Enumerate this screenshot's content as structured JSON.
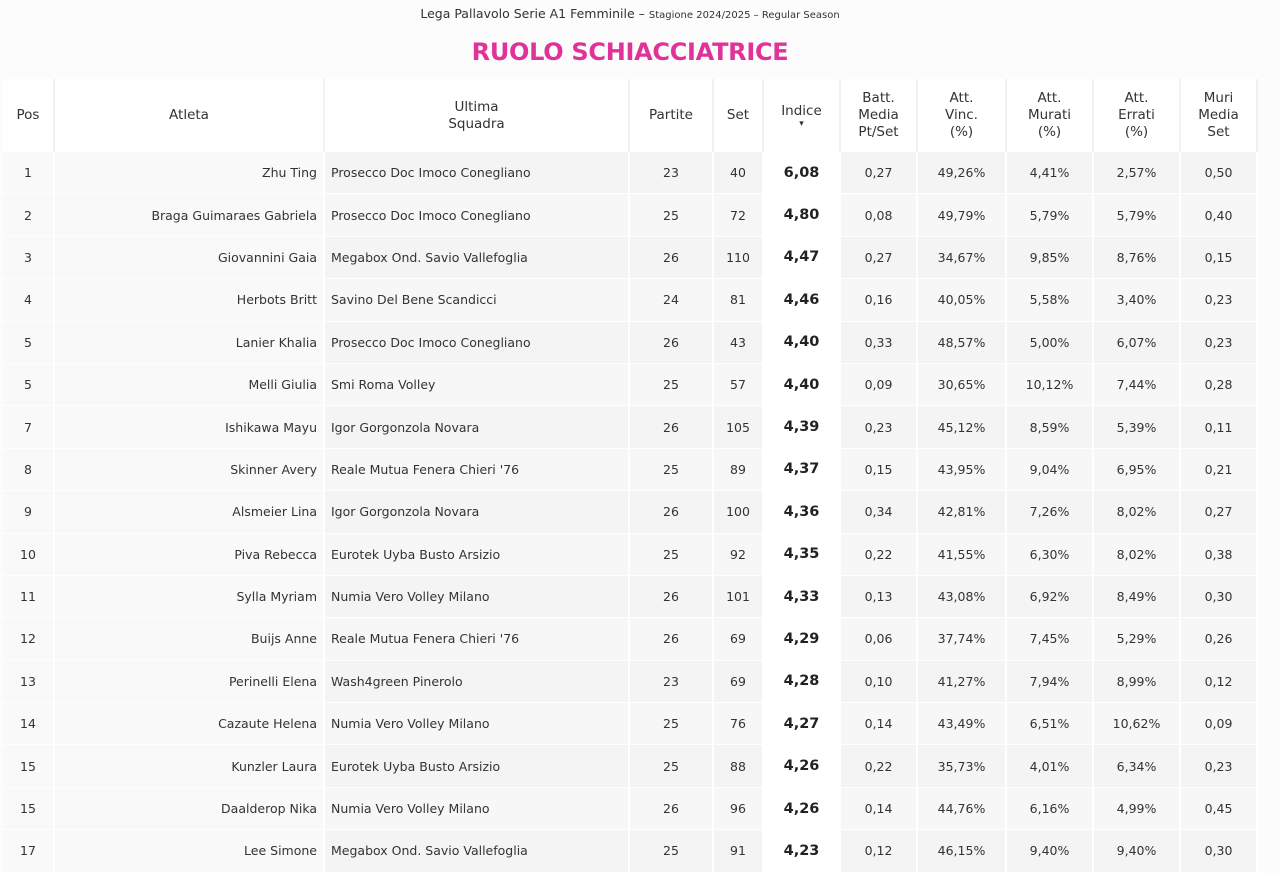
{
  "header": {
    "league": "Lega Pallavolo Serie A1 Femminile –",
    "season": "Stagione 2024/2025 – Regular Season",
    "title": "RUOLO SCHIACCIATRICE"
  },
  "columns": {
    "pos": "Pos",
    "atleta": "Atleta",
    "squadra_1": "Ultima",
    "squadra_2": "Squadra",
    "partite": "Partite",
    "set": "Set",
    "indice": "Indice",
    "sort_icon": "▾",
    "batt_1": "Batt.",
    "batt_2": "Media",
    "batt_3": "Pt/Set",
    "vinc_1": "Att.",
    "vinc_2": "Vinc.",
    "vinc_3": "(%)",
    "murati_1": "Att.",
    "murati_2": "Murati",
    "murati_3": "(%)",
    "errati_1": "Att.",
    "errati_2": "Errati",
    "errati_3": "(%)",
    "muri_1": "Muri",
    "muri_2": "Media",
    "muri_3": "Set"
  },
  "rows": [
    {
      "pos": "1",
      "atleta": "Zhu Ting",
      "squadra": "Prosecco Doc Imoco Conegliano",
      "partite": "23",
      "set": "40",
      "indice": "6,08",
      "batt": "0,27",
      "vinc": "49,26%",
      "murati": "4,41%",
      "errati": "2,57%",
      "muri": "0,50"
    },
    {
      "pos": "2",
      "atleta": "Braga Guimaraes Gabriela",
      "squadra": "Prosecco Doc Imoco Conegliano",
      "partite": "25",
      "set": "72",
      "indice": "4,80",
      "batt": "0,08",
      "vinc": "49,79%",
      "murati": "5,79%",
      "errati": "5,79%",
      "muri": "0,40"
    },
    {
      "pos": "3",
      "atleta": "Giovannini Gaia",
      "squadra": "Megabox Ond. Savio Vallefoglia",
      "partite": "26",
      "set": "110",
      "indice": "4,47",
      "batt": "0,27",
      "vinc": "34,67%",
      "murati": "9,85%",
      "errati": "8,76%",
      "muri": "0,15"
    },
    {
      "pos": "4",
      "atleta": "Herbots Britt",
      "squadra": "Savino Del Bene Scandicci",
      "partite": "24",
      "set": "81",
      "indice": "4,46",
      "batt": "0,16",
      "vinc": "40,05%",
      "murati": "5,58%",
      "errati": "3,40%",
      "muri": "0,23"
    },
    {
      "pos": "5",
      "atleta": "Lanier Khalia",
      "squadra": "Prosecco Doc Imoco Conegliano",
      "partite": "26",
      "set": "43",
      "indice": "4,40",
      "batt": "0,33",
      "vinc": "48,57%",
      "murati": "5,00%",
      "errati": "6,07%",
      "muri": "0,23"
    },
    {
      "pos": "5",
      "atleta": "Melli Giulia",
      "squadra": "Smi Roma Volley",
      "partite": "25",
      "set": "57",
      "indice": "4,40",
      "batt": "0,09",
      "vinc": "30,65%",
      "murati": "10,12%",
      "errati": "7,44%",
      "muri": "0,28"
    },
    {
      "pos": "7",
      "atleta": "Ishikawa Mayu",
      "squadra": "Igor Gorgonzola Novara",
      "partite": "26",
      "set": "105",
      "indice": "4,39",
      "batt": "0,23",
      "vinc": "45,12%",
      "murati": "8,59%",
      "errati": "5,39%",
      "muri": "0,11"
    },
    {
      "pos": "8",
      "atleta": "Skinner Avery",
      "squadra": "Reale Mutua Fenera Chieri '76",
      "partite": "25",
      "set": "89",
      "indice": "4,37",
      "batt": "0,15",
      "vinc": "43,95%",
      "murati": "9,04%",
      "errati": "6,95%",
      "muri": "0,21"
    },
    {
      "pos": "9",
      "atleta": "Alsmeier Lina",
      "squadra": "Igor Gorgonzola Novara",
      "partite": "26",
      "set": "100",
      "indice": "4,36",
      "batt": "0,34",
      "vinc": "42,81%",
      "murati": "7,26%",
      "errati": "8,02%",
      "muri": "0,27"
    },
    {
      "pos": "10",
      "atleta": "Piva Rebecca",
      "squadra": "Eurotek Uyba Busto Arsizio",
      "partite": "25",
      "set": "92",
      "indice": "4,35",
      "batt": "0,22",
      "vinc": "41,55%",
      "murati": "6,30%",
      "errati": "8,02%",
      "muri": "0,38"
    },
    {
      "pos": "11",
      "atleta": "Sylla Myriam",
      "squadra": "Numia Vero Volley Milano",
      "partite": "26",
      "set": "101",
      "indice": "4,33",
      "batt": "0,13",
      "vinc": "43,08%",
      "murati": "6,92%",
      "errati": "8,49%",
      "muri": "0,30"
    },
    {
      "pos": "12",
      "atleta": "Buijs Anne",
      "squadra": "Reale Mutua Fenera Chieri '76",
      "partite": "26",
      "set": "69",
      "indice": "4,29",
      "batt": "0,06",
      "vinc": "37,74%",
      "murati": "7,45%",
      "errati": "5,29%",
      "muri": "0,26"
    },
    {
      "pos": "13",
      "atleta": "Perinelli Elena",
      "squadra": "Wash4green Pinerolo",
      "partite": "23",
      "set": "69",
      "indice": "4,28",
      "batt": "0,10",
      "vinc": "41,27%",
      "murati": "7,94%",
      "errati": "8,99%",
      "muri": "0,12"
    },
    {
      "pos": "14",
      "atleta": "Cazaute Helena",
      "squadra": "Numia Vero Volley Milano",
      "partite": "25",
      "set": "76",
      "indice": "4,27",
      "batt": "0,14",
      "vinc": "43,49%",
      "murati": "6,51%",
      "errati": "10,62%",
      "muri": "0,09"
    },
    {
      "pos": "15",
      "atleta": "Kunzler Laura",
      "squadra": "Eurotek Uyba Busto Arsizio",
      "partite": "25",
      "set": "88",
      "indice": "4,26",
      "batt": "0,22",
      "vinc": "35,73%",
      "murati": "4,01%",
      "errati": "6,34%",
      "muri": "0,23"
    },
    {
      "pos": "15",
      "atleta": "Daalderop Nika",
      "squadra": "Numia Vero Volley Milano",
      "partite": "26",
      "set": "96",
      "indice": "4,26",
      "batt": "0,14",
      "vinc": "44,76%",
      "murati": "6,16%",
      "errati": "4,99%",
      "muri": "0,45"
    },
    {
      "pos": "17",
      "atleta": "Lee Simone",
      "squadra": "Megabox Ond. Savio Vallefoglia",
      "partite": "25",
      "set": "91",
      "indice": "4,23",
      "batt": "0,12",
      "vinc": "46,15%",
      "murati": "9,40%",
      "errati": "9,40%",
      "muri": "0,30"
    }
  ]
}
